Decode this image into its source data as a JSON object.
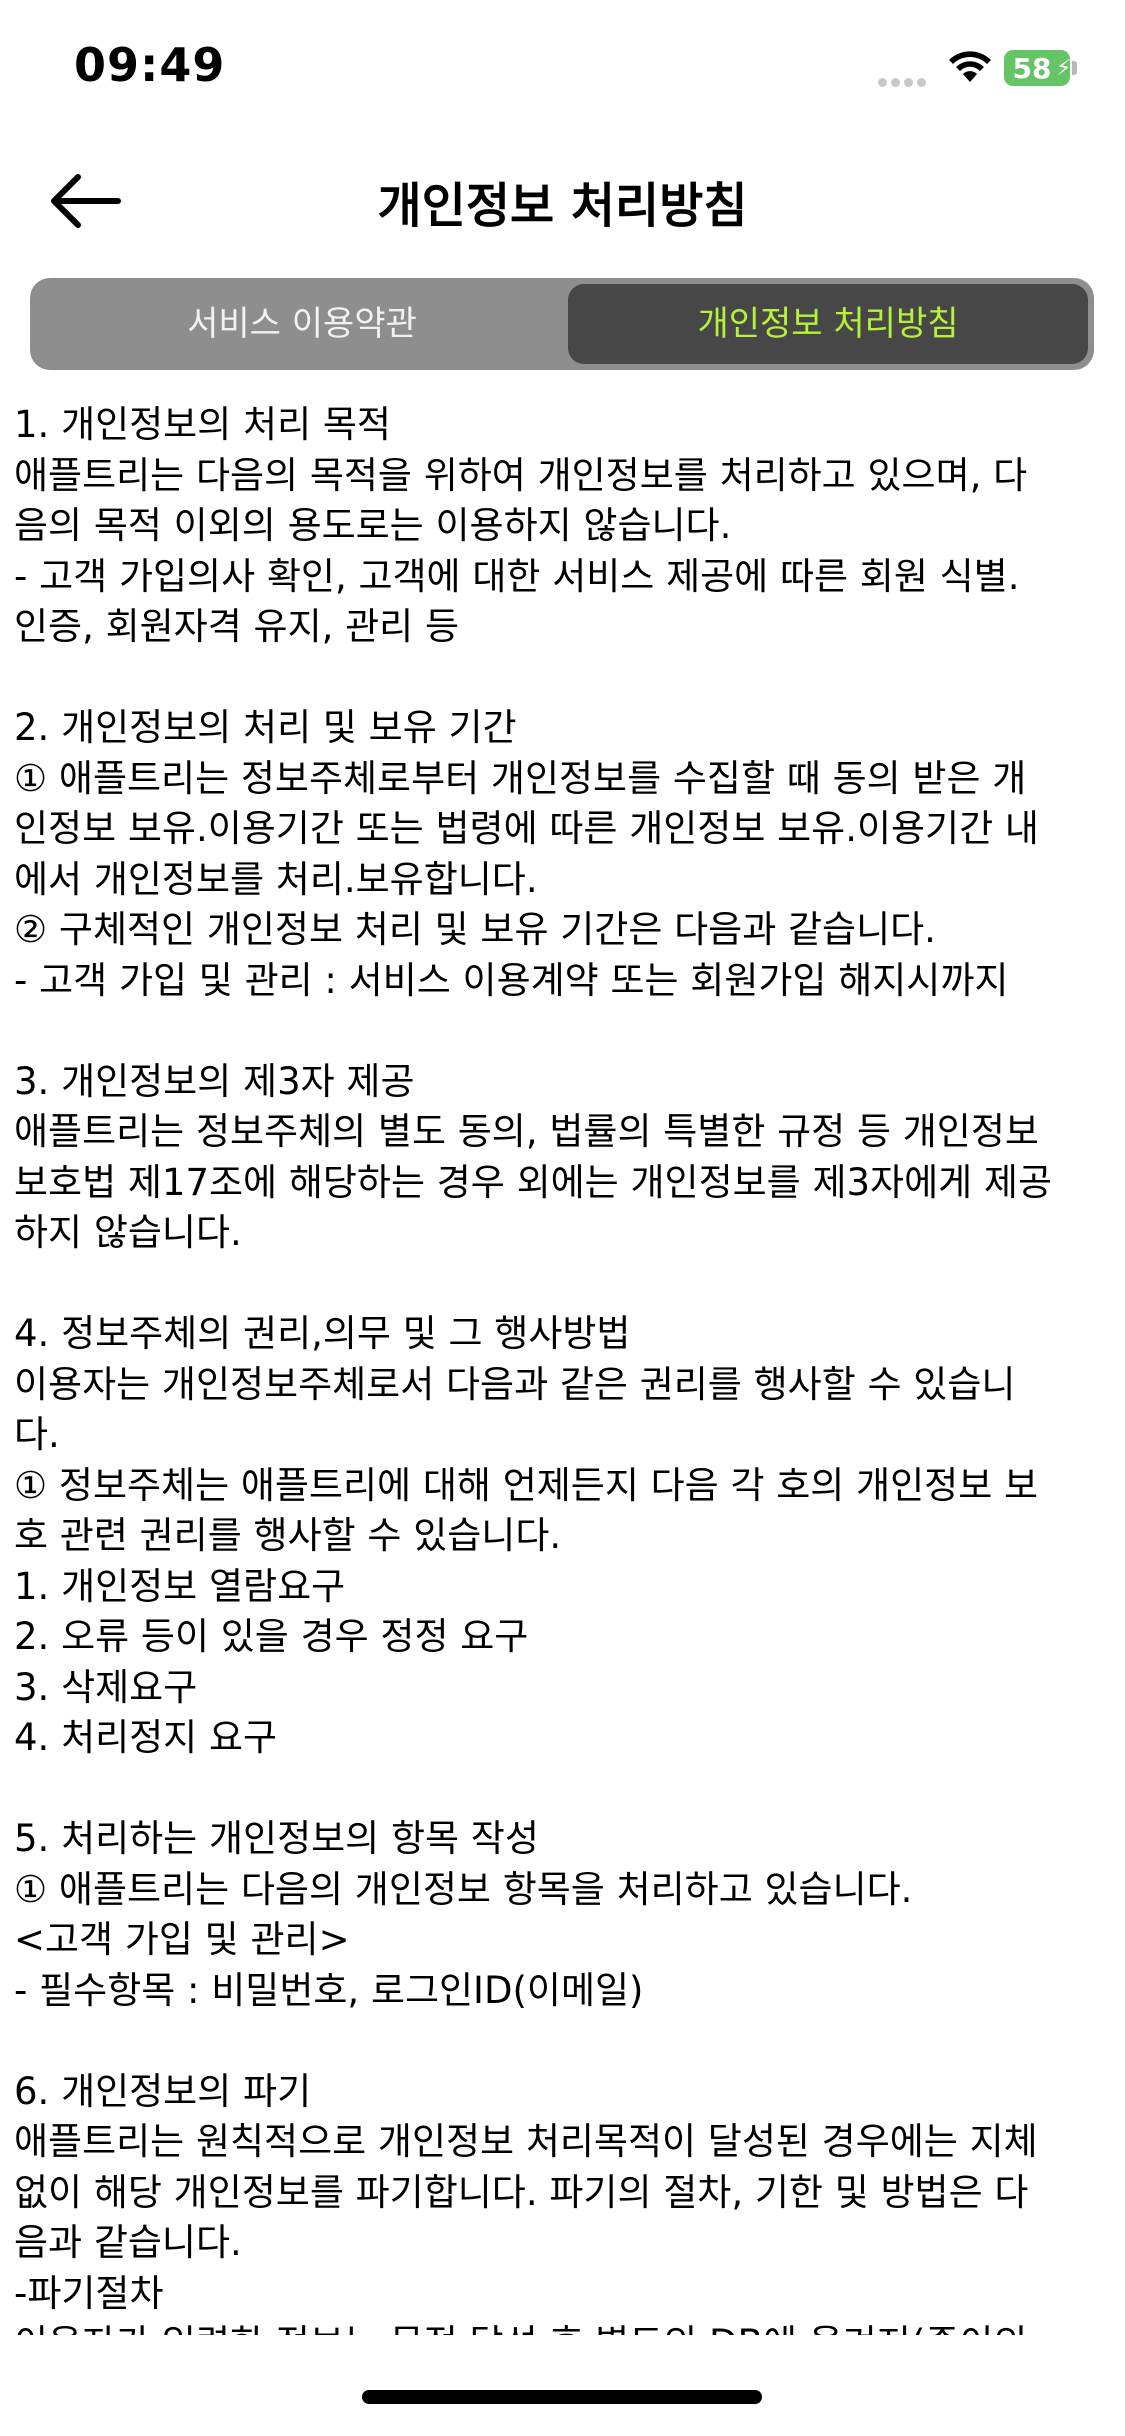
{
  "status_bar": {
    "time": "09:49",
    "battery_percent": "58"
  },
  "nav": {
    "title": "개인정보 처리방침"
  },
  "tabs": [
    {
      "label": "서비스 이용약관",
      "selected": false
    },
    {
      "label": "개인정보 처리방침",
      "selected": true
    }
  ],
  "colors": {
    "active_tab_text": "#b7f23b",
    "active_tab_bg": "#474747",
    "segment_bg": "#8e8e8e",
    "battery": "#65c466"
  },
  "content": {
    "lines": [
      "1. 개인정보의 처리 목적",
      "애플트리는 다음의 목적을 위하여 개인정보를 처리하고 있으며, 다",
      "음의 목적 이외의 용도로는 이용하지 않습니다.",
      "- 고객 가입의사 확인, 고객에 대한 서비스 제공에 따른 회원 식별.",
      "인증, 회원자격 유지, 관리 등",
      "",
      "2. 개인정보의 처리 및 보유 기간",
      "① 애플트리는 정보주체로부터 개인정보를 수집할 때 동의 받은 개",
      "인정보 보유.이용기간 또는 법령에 따른 개인정보 보유.이용기간 내",
      "에서 개인정보를 처리.보유합니다.",
      "② 구체적인 개인정보 처리 및 보유 기간은 다음과 같습니다.",
      "- 고객 가입 및 관리 : 서비스 이용계약 또는 회원가입 해지시까지",
      "",
      "3. 개인정보의 제3자 제공",
      "애플트리는 정보주체의 별도 동의, 법률의 특별한 규정 등 개인정보",
      "보호법 제17조에 해당하는 경우 외에는 개인정보를 제3자에게 제공",
      "하지 않습니다.",
      "",
      "4. 정보주체의 권리,의무 및 그 행사방법",
      "이용자는 개인정보주체로서 다음과 같은 권리를 행사할 수 있습니",
      "다.",
      "① 정보주체는 애플트리에 대해 언제든지 다음 각 호의 개인정보 보",
      "호 관련 권리를 행사할 수 있습니다.",
      "1. 개인정보 열람요구",
      "2. 오류 등이 있을 경우 정정 요구",
      "3. 삭제요구",
      "4. 처리정지 요구",
      "",
      "5. 처리하는 개인정보의 항목 작성",
      "① 애플트리는 다음의 개인정보 항목을 처리하고 있습니다.",
      "<고객 가입 및 관리>",
      "- 필수항목 : 비밀번호, 로그인ID(이메일)",
      "",
      "6. 개인정보의 파기",
      "애플트리는 원칙적으로 개인정보 처리목적이 달성된 경우에는 지체",
      "없이 해당 개인정보를 파기합니다. 파기의 절차, 기한 및 방법은 다",
      "음과 같습니다.",
      "-파기절차",
      "이용자가 입력한 정보는 목적 달성 후 별도의 DB에 옮겨져(종이의"
    ]
  }
}
